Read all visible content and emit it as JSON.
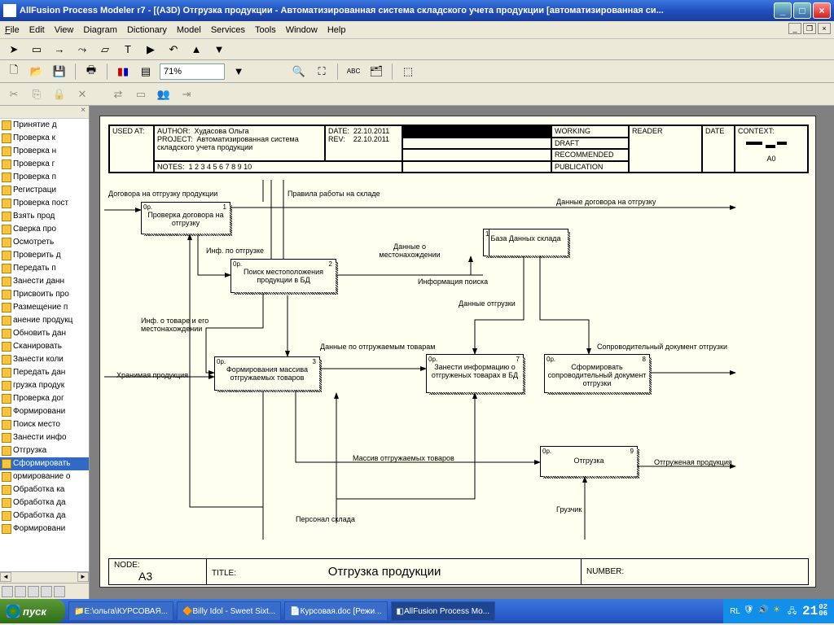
{
  "window": {
    "title": "AllFusion Process Modeler r7 - [(A3D) Отгрузка продукции - Автоматизированная система складского учета продукции [автоматизированная си..."
  },
  "menu": {
    "file": "File",
    "edit": "Edit",
    "view": "View",
    "diagram": "Diagram",
    "dictionary": "Dictionary",
    "model": "Model",
    "services": "Services",
    "tools": "Tools",
    "window": "Window",
    "help": "Help"
  },
  "zoom": "71%",
  "sidebar": {
    "items": [
      "Принятие д",
      "Проверка к",
      "Проверка н",
      "Проверка г",
      "Проверка п",
      "Регистраци",
      "Проверка пост",
      "Взять прод",
      "Сверка про",
      "Осмотреть",
      "Проверить д",
      "Передать п",
      "Занести данн",
      "Присвоить про",
      "Размещение п",
      "анение продукц",
      "Обновить дан",
      "Сканировать",
      "Занести коли",
      "Передать дан",
      "грузка продук",
      "Проверка дог",
      "Формировани",
      "Поиск место",
      "Занести инфо",
      "Отгрузка"
    ],
    "selected": "Сформировать",
    "after": [
      "ормирование о",
      "Обработка ка",
      "Обработка да",
      "Обработка да",
      "Формировани"
    ]
  },
  "header": {
    "used_at": "USED AT:",
    "author_lbl": "AUTHOR:",
    "author": "Худасова Ольга",
    "project_lbl": "PROJECT:",
    "project": "Автоматизированная система складского учета продукции",
    "date_lbl": "DATE:",
    "date": "22.10.2011",
    "rev_lbl": "REV:",
    "rev": "22.10.2011",
    "notes_lbl": "NOTES:",
    "notes": "1  2  3  4  5  6  7  8  9  10",
    "working": "WORKING",
    "draft": "DRAFT",
    "recommended": "RECOMMENDED",
    "publication": "PUBLICATION",
    "reader": "READER",
    "hdate": "DATE",
    "context": "CONTEXT:",
    "a0": "A0"
  },
  "nodes": {
    "n1": {
      "op": "0р.",
      "id": "1",
      "text": "Проверка договора на отгрузку"
    },
    "n2": {
      "op": "0р.",
      "id": "2",
      "text": "Поиск местоположения продукции в БД"
    },
    "n3": {
      "op": "0р.",
      "id": "3",
      "text": "Формирования массива отгружаемых товаров"
    },
    "n7": {
      "op": "0р.",
      "id": "7",
      "text": "Занести информацию о отгруженых товарах в БД"
    },
    "n8": {
      "op": "0р.",
      "id": "8",
      "text": "Сформировать сопроводительный документ отгрузки"
    },
    "n9": {
      "op": "0р.",
      "id": "9",
      "text": "Отгрузка"
    },
    "db": {
      "id": "1",
      "text": "База Данных склада"
    }
  },
  "arrows": {
    "a1": "Договора на отгрузку продукции",
    "a2": "Правила работы на складе",
    "a3": "Данные договора на отгрузку",
    "a4": "Инф. по отгрузке",
    "a5": "Данные о местонахождении",
    "a6": "Информация поиска",
    "a7": "Данные отгрузки",
    "a8": "Инф. о товаре и его местонахождении",
    "a9": "Хранимая продукция",
    "a10": "Данные по отгружаемым товарам",
    "a11": "Сопроводительный документ отгрузки",
    "a12": "Массив отгружаемых товаров",
    "a13": "Отгруженая продукция",
    "a14": "Персонал склада",
    "a15": "Грузчик"
  },
  "footer": {
    "node_lbl": "NODE:",
    "node": "A3",
    "title_lbl": "TITLE:",
    "title": "Отгрузка продукции",
    "number_lbl": "NUMBER:"
  },
  "taskbar": {
    "start": "пуск",
    "tasks": [
      "Е:\\ольга\\КУРСОВАЯ...",
      "Billy Idol - Sweet Sixt...",
      "Курсовая.doc [Режи...",
      "AllFusion Process Mo..."
    ],
    "lang": "RL",
    "time": "21",
    "min": "02",
    "sec": "06"
  }
}
